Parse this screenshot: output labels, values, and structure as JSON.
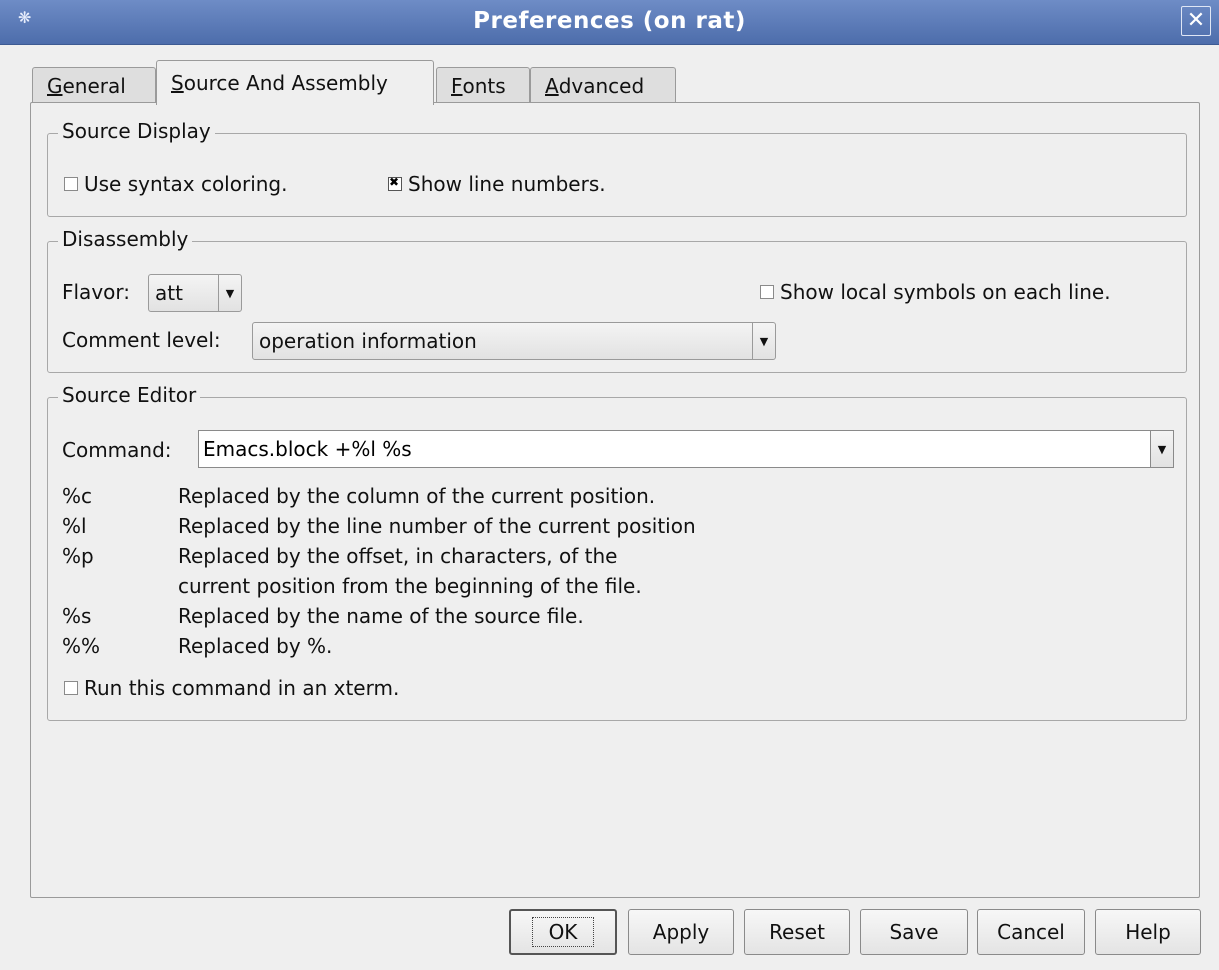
{
  "window": {
    "title": "Preferences (on rat)"
  },
  "tabs": [
    {
      "pre": "",
      "key": "G",
      "post": "eneral"
    },
    {
      "pre": "",
      "key": "S",
      "post": "ource And Assembly"
    },
    {
      "pre": "",
      "key": "F",
      "post": "onts"
    },
    {
      "pre": "",
      "key": "A",
      "post": "dvanced"
    }
  ],
  "active_tab": 1,
  "source_display": {
    "legend": "Source Display",
    "syntax_coloring": {
      "label": "Use syntax coloring.",
      "checked": false
    },
    "line_numbers": {
      "label": "Show line numbers.",
      "checked": true
    }
  },
  "disassembly": {
    "legend": "Disassembly",
    "flavor_label": "Flavor:",
    "flavor_value": "att",
    "local_symbols": {
      "label": "Show local symbols on each line.",
      "checked": false
    },
    "comment_label": "Comment level:",
    "comment_value": "operation information"
  },
  "source_editor": {
    "legend": "Source Editor",
    "command_label": "Command:",
    "command_value": "Emacs.block +%l %s",
    "help": [
      {
        "code": "%c",
        "desc": "Replaced by the column of the current position."
      },
      {
        "code": "%l",
        "desc": "Replaced by the line number of the current position"
      },
      {
        "code": "%p",
        "desc": "Replaced by the offset, in characters, of the"
      },
      {
        "code": "",
        "desc": "current position from the beginning of the file."
      },
      {
        "code": "%s",
        "desc": "Replaced by the name of the source file."
      },
      {
        "code": "%%",
        "desc": "Replaced by %."
      }
    ],
    "xterm": {
      "label": "Run this command in an xterm.",
      "checked": false
    }
  },
  "buttons": {
    "ok": "OK",
    "apply": "Apply",
    "reset": "Reset",
    "save": "Save",
    "cancel": "Cancel",
    "help": "Help"
  },
  "colors": {
    "titlebar": "#5b7bb8",
    "background": "#efefef"
  }
}
